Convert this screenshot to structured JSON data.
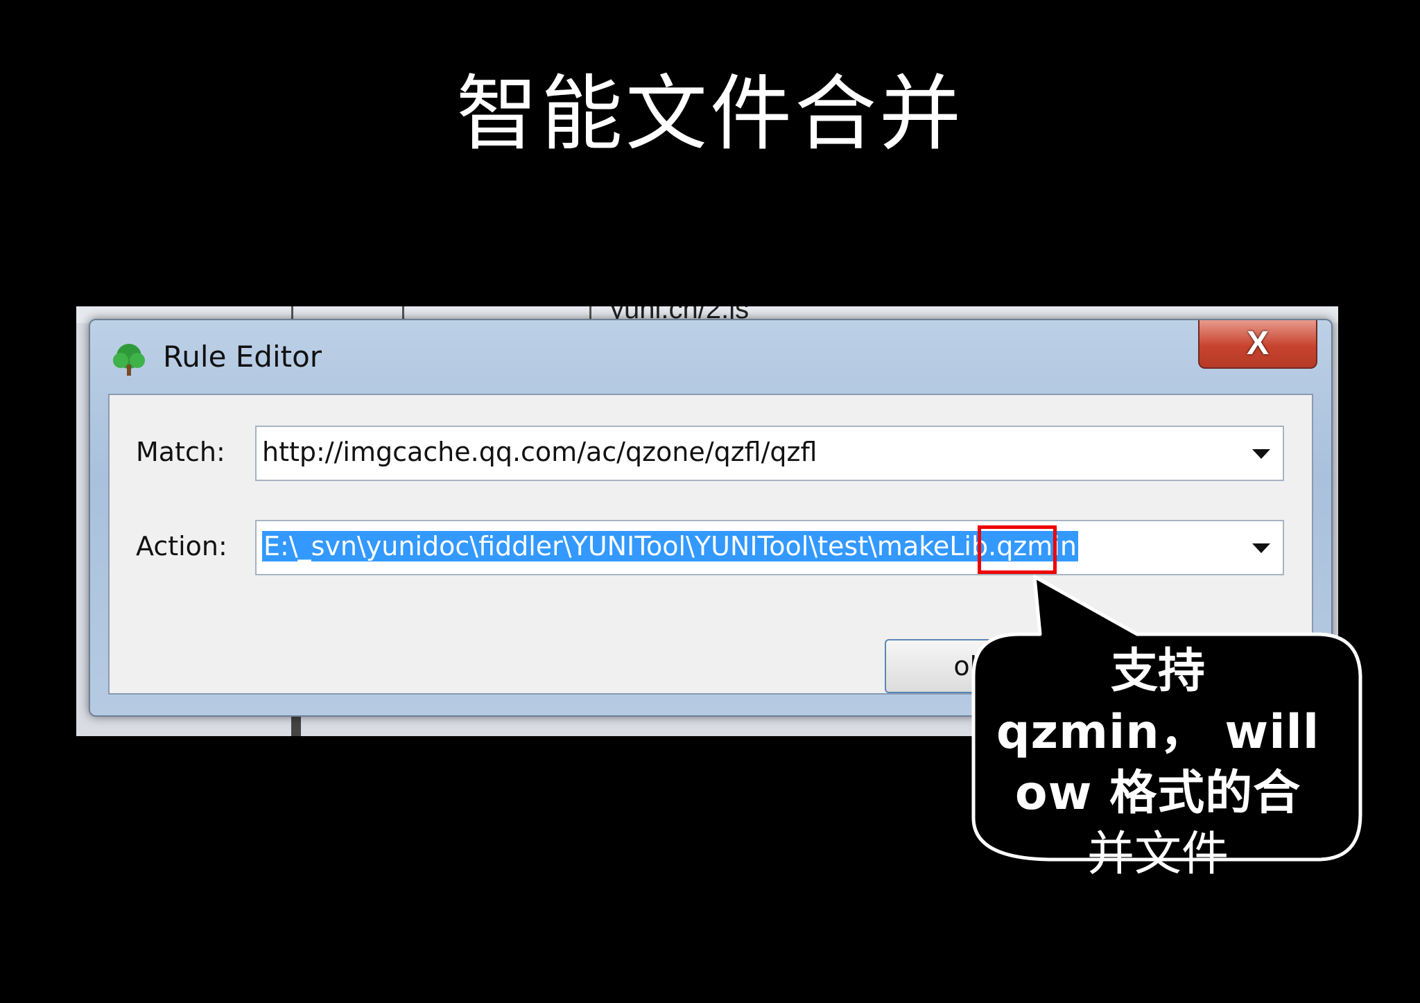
{
  "slide": {
    "title": "智能文件合并"
  },
  "background_app": {
    "partial_text": "yuni.cn/2.js"
  },
  "dialog": {
    "title": "Rule Editor",
    "close_glyph": "X",
    "match": {
      "label": "Match:",
      "value": "http://imgcache.qq.com/ac/qzone/qzfl/qzfl"
    },
    "action": {
      "label": "Action:",
      "value": "E:\\_svn\\yunidoc\\fiddler\\YUNITool\\YUNITool\\test\\makeLib.qzmin"
    },
    "ok_button": "ok"
  },
  "callout": {
    "line1": "支持",
    "line2": "qzmin， will",
    "line3": "ow 格式的合",
    "line4": "并文件"
  },
  "colors": {
    "background": "#000000",
    "selection": "#3399ff",
    "highlight": "#ee0000",
    "close_button": "#c8432e"
  }
}
